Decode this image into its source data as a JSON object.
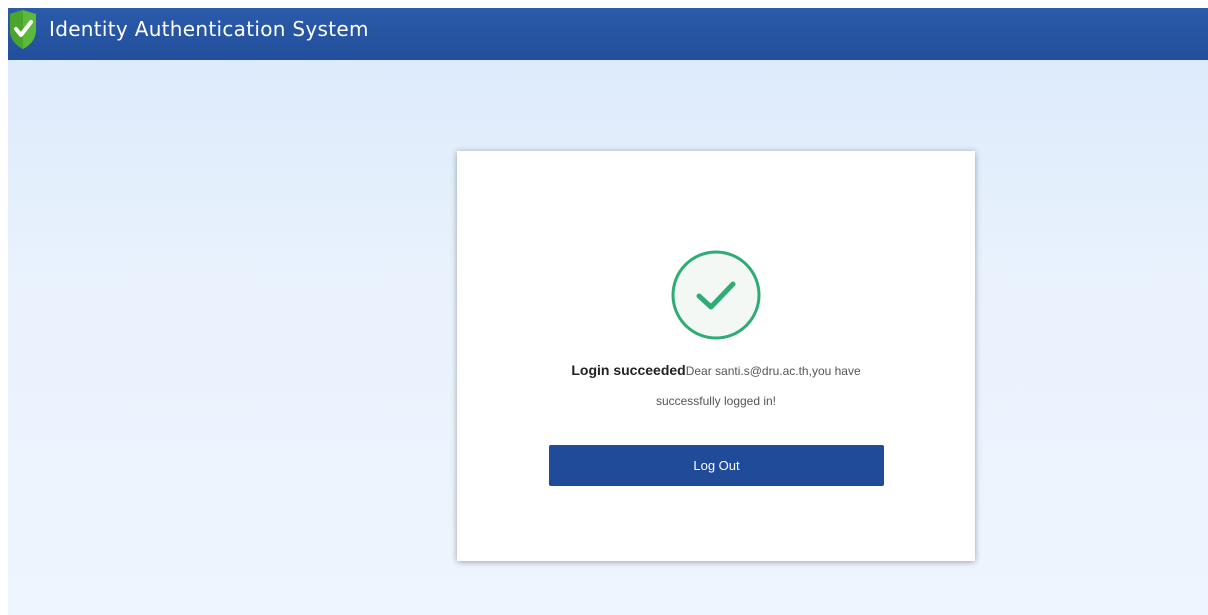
{
  "header": {
    "title": "Identity Authentication System",
    "logo_icon": "shield-check-icon",
    "background": "#2653a3"
  },
  "card": {
    "status_icon": "check-circle-icon",
    "status_color": "#2eac74",
    "message_strong": "Login succeeded",
    "message_line1": "Dear santi.s@dru.ac.th,you have",
    "message_line2": "successfully logged in!",
    "logout_label": "Log Out",
    "button_color": "#1f4b98"
  }
}
